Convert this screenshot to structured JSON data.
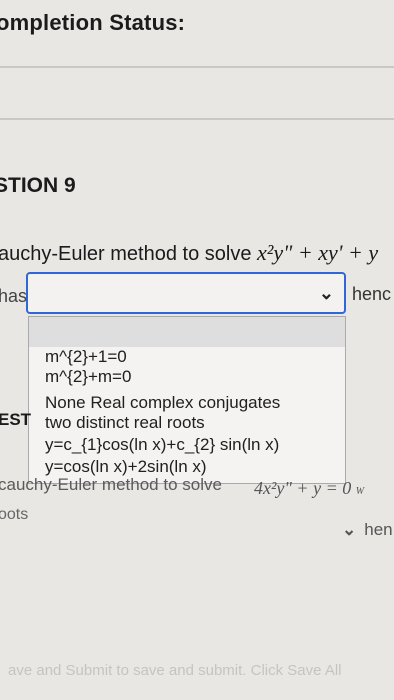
{
  "header": {
    "completion_status": "ompletion Status:"
  },
  "question9": {
    "title": "STION 9",
    "prompt": "auchy-Euler method to solve",
    "equation": "x²y\" + xy' + y",
    "left_label": "has",
    "right_label": "henc",
    "dropdown": {
      "selected_value": "",
      "options": [
        "m^{2}+1=0",
        "m^{2}+m=0",
        "None Real complex conjugates",
        "two distinct real roots",
        "y=c_{1}cos(ln x)+c_{2} sin(ln x)",
        "y=cos(ln x)+2sin(ln x)"
      ]
    }
  },
  "question10": {
    "label": "EST",
    "prompt": "cauchy-Euler method to solve",
    "equation": "4x²y\" + y = 0",
    "equation_suffix": "W",
    "roots_label": "oots",
    "right_label": "hen"
  },
  "footer": {
    "note": "ave and Submit to save and submit. Click Save All"
  }
}
